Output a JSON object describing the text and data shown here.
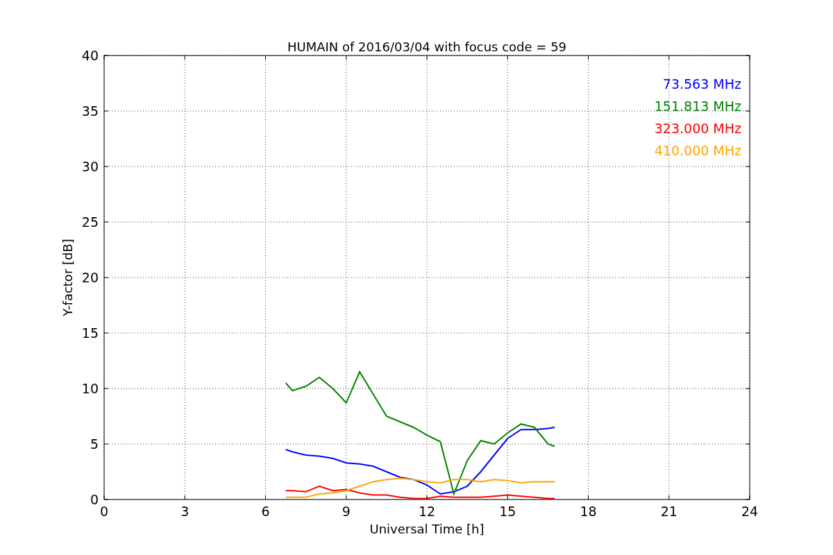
{
  "figure": {
    "chart_data": {
      "type": "line",
      "title": "HUMAIN of 2016/03/04 with focus code = 59",
      "xlabel": "Universal Time [h]",
      "ylabel": "Y-factor [dB]",
      "grid": true,
      "xlim": [
        0,
        24
      ],
      "ylim": [
        0,
        40
      ],
      "xticks": [
        0,
        3,
        6,
        9,
        12,
        15,
        18,
        21,
        24
      ],
      "yticks": [
        0,
        5,
        10,
        15,
        20,
        25,
        30,
        35,
        40
      ],
      "x": [
        6.75,
        7,
        7.5,
        8,
        8.5,
        9,
        9.5,
        10,
        10.5,
        11,
        11.5,
        12,
        12.5,
        13,
        13.5,
        14,
        14.5,
        15,
        15.5,
        16,
        16.5,
        16.75
      ],
      "series": [
        {
          "name": "73.563 MHz",
          "color": "#0000ff",
          "values": [
            4.5,
            4.3,
            4.0,
            3.9,
            3.7,
            3.3,
            3.2,
            3.0,
            2.5,
            2.0,
            1.8,
            1.3,
            0.5,
            0.7,
            1.2,
            2.5,
            4.0,
            5.5,
            6.3,
            6.3,
            6.4,
            6.5
          ]
        },
        {
          "name": "151.813 MHz",
          "color": "#008000",
          "values": [
            10.5,
            9.8,
            10.2,
            11.0,
            10.0,
            8.7,
            11.5,
            9.5,
            7.5,
            7.0,
            6.5,
            5.8,
            5.2,
            0.5,
            3.5,
            5.3,
            5.0,
            6.0,
            6.8,
            6.5,
            5.0,
            4.8
          ]
        },
        {
          "name": "323.000 MHz",
          "color": "#ff0000",
          "values": [
            0.8,
            0.8,
            0.7,
            1.2,
            0.8,
            0.9,
            0.6,
            0.4,
            0.4,
            0.2,
            0.1,
            0.1,
            0.3,
            0.2,
            0.2,
            0.2,
            0.3,
            0.4,
            0.3,
            0.2,
            0.1,
            0.1
          ]
        },
        {
          "name": "410.000 MHz",
          "color": "#ffa500",
          "values": [
            0.2,
            0.2,
            0.2,
            0.5,
            0.6,
            0.8,
            1.2,
            1.6,
            1.8,
            1.9,
            1.8,
            1.6,
            1.5,
            1.8,
            1.8,
            1.6,
            1.8,
            1.7,
            1.5,
            1.6,
            1.6,
            1.6
          ]
        }
      ]
    }
  }
}
